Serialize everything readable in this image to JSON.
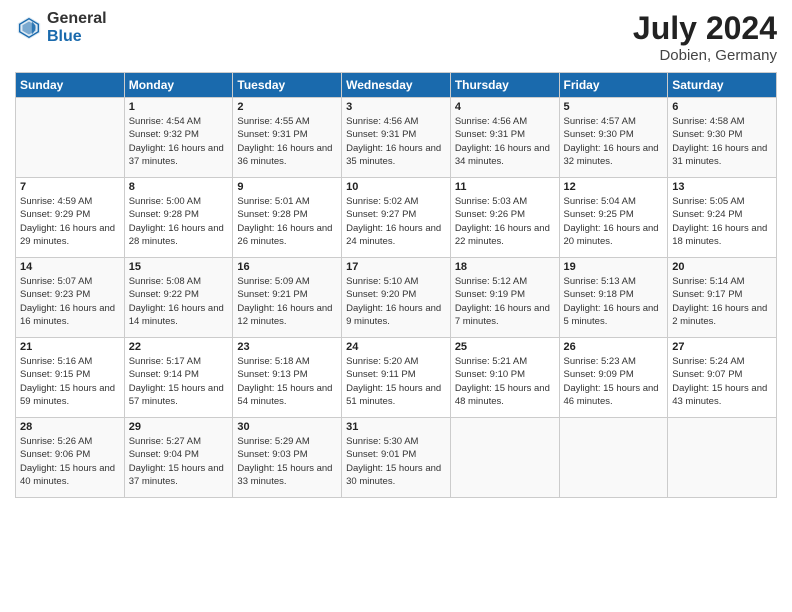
{
  "header": {
    "logo_general": "General",
    "logo_blue": "Blue",
    "month_year": "July 2024",
    "location": "Dobien, Germany"
  },
  "weekdays": [
    "Sunday",
    "Monday",
    "Tuesday",
    "Wednesday",
    "Thursday",
    "Friday",
    "Saturday"
  ],
  "weeks": [
    [
      {
        "day": "",
        "sunrise": "",
        "sunset": "",
        "daylight": ""
      },
      {
        "day": "1",
        "sunrise": "Sunrise: 4:54 AM",
        "sunset": "Sunset: 9:32 PM",
        "daylight": "Daylight: 16 hours and 37 minutes."
      },
      {
        "day": "2",
        "sunrise": "Sunrise: 4:55 AM",
        "sunset": "Sunset: 9:31 PM",
        "daylight": "Daylight: 16 hours and 36 minutes."
      },
      {
        "day": "3",
        "sunrise": "Sunrise: 4:56 AM",
        "sunset": "Sunset: 9:31 PM",
        "daylight": "Daylight: 16 hours and 35 minutes."
      },
      {
        "day": "4",
        "sunrise": "Sunrise: 4:56 AM",
        "sunset": "Sunset: 9:31 PM",
        "daylight": "Daylight: 16 hours and 34 minutes."
      },
      {
        "day": "5",
        "sunrise": "Sunrise: 4:57 AM",
        "sunset": "Sunset: 9:30 PM",
        "daylight": "Daylight: 16 hours and 32 minutes."
      },
      {
        "day": "6",
        "sunrise": "Sunrise: 4:58 AM",
        "sunset": "Sunset: 9:30 PM",
        "daylight": "Daylight: 16 hours and 31 minutes."
      }
    ],
    [
      {
        "day": "7",
        "sunrise": "Sunrise: 4:59 AM",
        "sunset": "Sunset: 9:29 PM",
        "daylight": "Daylight: 16 hours and 29 minutes."
      },
      {
        "day": "8",
        "sunrise": "Sunrise: 5:00 AM",
        "sunset": "Sunset: 9:28 PM",
        "daylight": "Daylight: 16 hours and 28 minutes."
      },
      {
        "day": "9",
        "sunrise": "Sunrise: 5:01 AM",
        "sunset": "Sunset: 9:28 PM",
        "daylight": "Daylight: 16 hours and 26 minutes."
      },
      {
        "day": "10",
        "sunrise": "Sunrise: 5:02 AM",
        "sunset": "Sunset: 9:27 PM",
        "daylight": "Daylight: 16 hours and 24 minutes."
      },
      {
        "day": "11",
        "sunrise": "Sunrise: 5:03 AM",
        "sunset": "Sunset: 9:26 PM",
        "daylight": "Daylight: 16 hours and 22 minutes."
      },
      {
        "day": "12",
        "sunrise": "Sunrise: 5:04 AM",
        "sunset": "Sunset: 9:25 PM",
        "daylight": "Daylight: 16 hours and 20 minutes."
      },
      {
        "day": "13",
        "sunrise": "Sunrise: 5:05 AM",
        "sunset": "Sunset: 9:24 PM",
        "daylight": "Daylight: 16 hours and 18 minutes."
      }
    ],
    [
      {
        "day": "14",
        "sunrise": "Sunrise: 5:07 AM",
        "sunset": "Sunset: 9:23 PM",
        "daylight": "Daylight: 16 hours and 16 minutes."
      },
      {
        "day": "15",
        "sunrise": "Sunrise: 5:08 AM",
        "sunset": "Sunset: 9:22 PM",
        "daylight": "Daylight: 16 hours and 14 minutes."
      },
      {
        "day": "16",
        "sunrise": "Sunrise: 5:09 AM",
        "sunset": "Sunset: 9:21 PM",
        "daylight": "Daylight: 16 hours and 12 minutes."
      },
      {
        "day": "17",
        "sunrise": "Sunrise: 5:10 AM",
        "sunset": "Sunset: 9:20 PM",
        "daylight": "Daylight: 16 hours and 9 minutes."
      },
      {
        "day": "18",
        "sunrise": "Sunrise: 5:12 AM",
        "sunset": "Sunset: 9:19 PM",
        "daylight": "Daylight: 16 hours and 7 minutes."
      },
      {
        "day": "19",
        "sunrise": "Sunrise: 5:13 AM",
        "sunset": "Sunset: 9:18 PM",
        "daylight": "Daylight: 16 hours and 5 minutes."
      },
      {
        "day": "20",
        "sunrise": "Sunrise: 5:14 AM",
        "sunset": "Sunset: 9:17 PM",
        "daylight": "Daylight: 16 hours and 2 minutes."
      }
    ],
    [
      {
        "day": "21",
        "sunrise": "Sunrise: 5:16 AM",
        "sunset": "Sunset: 9:15 PM",
        "daylight": "Daylight: 15 hours and 59 minutes."
      },
      {
        "day": "22",
        "sunrise": "Sunrise: 5:17 AM",
        "sunset": "Sunset: 9:14 PM",
        "daylight": "Daylight: 15 hours and 57 minutes."
      },
      {
        "day": "23",
        "sunrise": "Sunrise: 5:18 AM",
        "sunset": "Sunset: 9:13 PM",
        "daylight": "Daylight: 15 hours and 54 minutes."
      },
      {
        "day": "24",
        "sunrise": "Sunrise: 5:20 AM",
        "sunset": "Sunset: 9:11 PM",
        "daylight": "Daylight: 15 hours and 51 minutes."
      },
      {
        "day": "25",
        "sunrise": "Sunrise: 5:21 AM",
        "sunset": "Sunset: 9:10 PM",
        "daylight": "Daylight: 15 hours and 48 minutes."
      },
      {
        "day": "26",
        "sunrise": "Sunrise: 5:23 AM",
        "sunset": "Sunset: 9:09 PM",
        "daylight": "Daylight: 15 hours and 46 minutes."
      },
      {
        "day": "27",
        "sunrise": "Sunrise: 5:24 AM",
        "sunset": "Sunset: 9:07 PM",
        "daylight": "Daylight: 15 hours and 43 minutes."
      }
    ],
    [
      {
        "day": "28",
        "sunrise": "Sunrise: 5:26 AM",
        "sunset": "Sunset: 9:06 PM",
        "daylight": "Daylight: 15 hours and 40 minutes."
      },
      {
        "day": "29",
        "sunrise": "Sunrise: 5:27 AM",
        "sunset": "Sunset: 9:04 PM",
        "daylight": "Daylight: 15 hours and 37 minutes."
      },
      {
        "day": "30",
        "sunrise": "Sunrise: 5:29 AM",
        "sunset": "Sunset: 9:03 PM",
        "daylight": "Daylight: 15 hours and 33 minutes."
      },
      {
        "day": "31",
        "sunrise": "Sunrise: 5:30 AM",
        "sunset": "Sunset: 9:01 PM",
        "daylight": "Daylight: 15 hours and 30 minutes."
      },
      {
        "day": "",
        "sunrise": "",
        "sunset": "",
        "daylight": ""
      },
      {
        "day": "",
        "sunrise": "",
        "sunset": "",
        "daylight": ""
      },
      {
        "day": "",
        "sunrise": "",
        "sunset": "",
        "daylight": ""
      }
    ]
  ]
}
